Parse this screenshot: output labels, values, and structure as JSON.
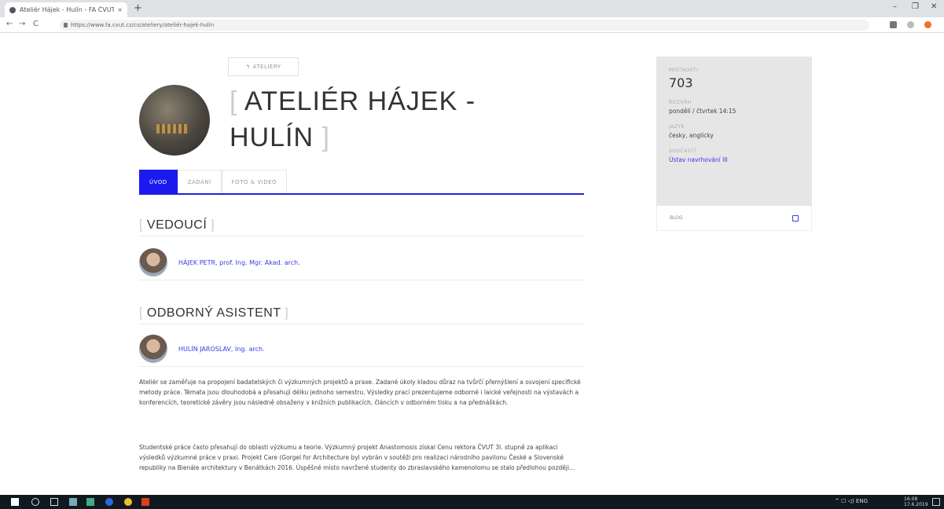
{
  "browser": {
    "tab_title": "Ateliér Hájek - Hulín - FA ČVUT",
    "tab_close": "×",
    "new_tab": "+",
    "url": "https://www.fa.cvut.cz/cs/ateliery/ateliér-hajek-hulin",
    "back": "←",
    "forward": "→",
    "reload": "C",
    "minimize": "–",
    "maximize": "❐"
  },
  "page": {
    "back_link": "↰ ATELIÉRY",
    "title_open": "[",
    "title_line1": "ATELIÉR HÁJEK -",
    "title_line2": "HULÍN",
    "title_close": "]"
  },
  "tabs": [
    {
      "label": "ÚVOD",
      "active": true
    },
    {
      "label": "ZADÁNÍ",
      "active": false
    },
    {
      "label": "FOTO & VIDEO",
      "active": false
    }
  ],
  "sections": {
    "lead": {
      "bracket_open": "[",
      "title": "VEDOUCÍ",
      "bracket_close": "]",
      "person": "HÁJEK PETR, prof. Ing. Mgr. Akad. arch."
    },
    "assistant": {
      "bracket_open": "[",
      "title": "ODBORNÝ ASISTENT",
      "bracket_close": "]",
      "person": "HULÍN JAROSLAV, Ing. arch."
    }
  },
  "body": {
    "para1": "Ateliér se zaměřuje na propojení badatelských či výzkumných projektů a praxe. Zadané úkoly kladou důraz na tvůrčí přemýšlení a osvojení specifické metody práce. Témata jsou dlouhodobá a přesahují délku jednoho semestru. Výsledky prací prezentujeme odborné i laické veřejnosti na výstavách a konferencích, teoretické závěry jsou následně obsaženy v knižních publikacích, článcích v odborném tisku a na přednáškách.",
    "para2": "Studentské práce často přesahují do oblasti výzkumu a teorie. Výzkumný projekt Anastomosis získal Cenu rektora ČVUT 3l. stupně za aplikaci výsledků výzkumné práce v praxi. Projekt Care (Gorgel for Architecture byl vybrán v soutěži pro realizaci národního pavilonu České a Slovenské republiky na Bienále architektury v Benátkách 2016. Úspěšné místo navržené studenty do zbraslavského kamenolomu se stalo předlohou později..."
  },
  "sidebar": {
    "rooms_label": "MÍSTNOSTI",
    "rooms_value": "703",
    "schedule_label": "ROZVRH",
    "schedule_value": "pondělí / čtvrtek 14:15",
    "language_label": "JAZYK",
    "language_value": "česky, anglicky",
    "parts_label": "SOUČÁSTÍ",
    "parts_value": "Ústav navrhování III",
    "blog_label": "BLOG"
  },
  "taskbar": {
    "tray_text": "^ ☐ ◁) ENG",
    "clock_time": "16:08",
    "clock_date": "17.6.2019"
  },
  "colors": {
    "accent": "#1a1aee",
    "link": "#3a3ae0",
    "sidebar_bg": "#e6e6e6",
    "taskbar_bg": "#101820"
  }
}
